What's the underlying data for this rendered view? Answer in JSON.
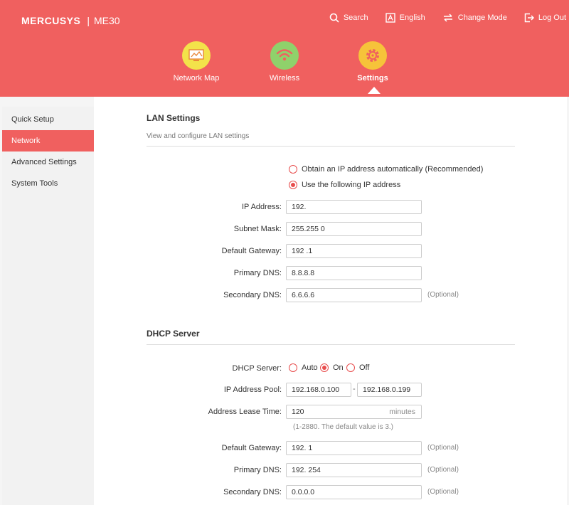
{
  "brand": {
    "logo": "MERCUSYS",
    "separator": "|",
    "model": "ME30"
  },
  "topnav": {
    "search": "Search",
    "language": "English",
    "change_mode": "Change Mode",
    "logout": "Log Out"
  },
  "mainnav": {
    "network_map": "Network Map",
    "wireless": "Wireless",
    "settings": "Settings"
  },
  "sidebar": {
    "items": [
      "Quick Setup",
      "Network",
      "Advanced Settings",
      "System Tools"
    ],
    "active": "Network"
  },
  "lan": {
    "title": "LAN Settings",
    "subtitle": "View and configure LAN settings",
    "option_auto": "Obtain an IP address automatically (Recommended)",
    "option_manual": "Use the following IP address",
    "selected": "manual",
    "ip_label": "IP Address:",
    "ip_value": "192.",
    "mask_label": "Subnet Mask:",
    "mask_value": "255.255        0",
    "gateway_label": "Default Gateway:",
    "gateway_value": "192          .1",
    "dns1_label": "Primary DNS:",
    "dns1_value": "8.8.8.8",
    "dns2_label": "Secondary DNS:",
    "dns2_value": "6.6.6.6",
    "optional": "(Optional)"
  },
  "dhcp": {
    "title": "DHCP Server",
    "server_label": "DHCP Server:",
    "opt_auto": "Auto",
    "opt_on": "On",
    "opt_off": "Off",
    "selected": "On",
    "pool_label": "IP Address Pool:",
    "pool_start": "192.168.0.100",
    "pool_dash": "-",
    "pool_end": "192.168.0.199",
    "lease_label": "Address Lease Time:",
    "lease_value": "120",
    "lease_unit": "minutes",
    "lease_hint": "(1-2880. The default value is 3.)",
    "gateway_label": "Default Gateway:",
    "gateway_value": "192.          1",
    "dns1_label": "Primary DNS:",
    "dns1_value": "192.          254",
    "dns2_label": "Secondary DNS:",
    "dns2_value": "0.0.0.0",
    "optional": "(Optional)"
  },
  "colors": {
    "accent": "#f0605f",
    "radio": "#e84d4d",
    "network_map_icon": "#f3e24a",
    "wireless_icon": "#8fd16b",
    "settings_icon": "#f6c33a"
  },
  "icons": {
    "search": "search-icon",
    "language": "language-a-icon",
    "change_mode": "swap-arrows-icon",
    "logout": "logout-icon",
    "network_map": "network-map-icon",
    "wireless": "wifi-icon",
    "settings": "gear-icon"
  }
}
